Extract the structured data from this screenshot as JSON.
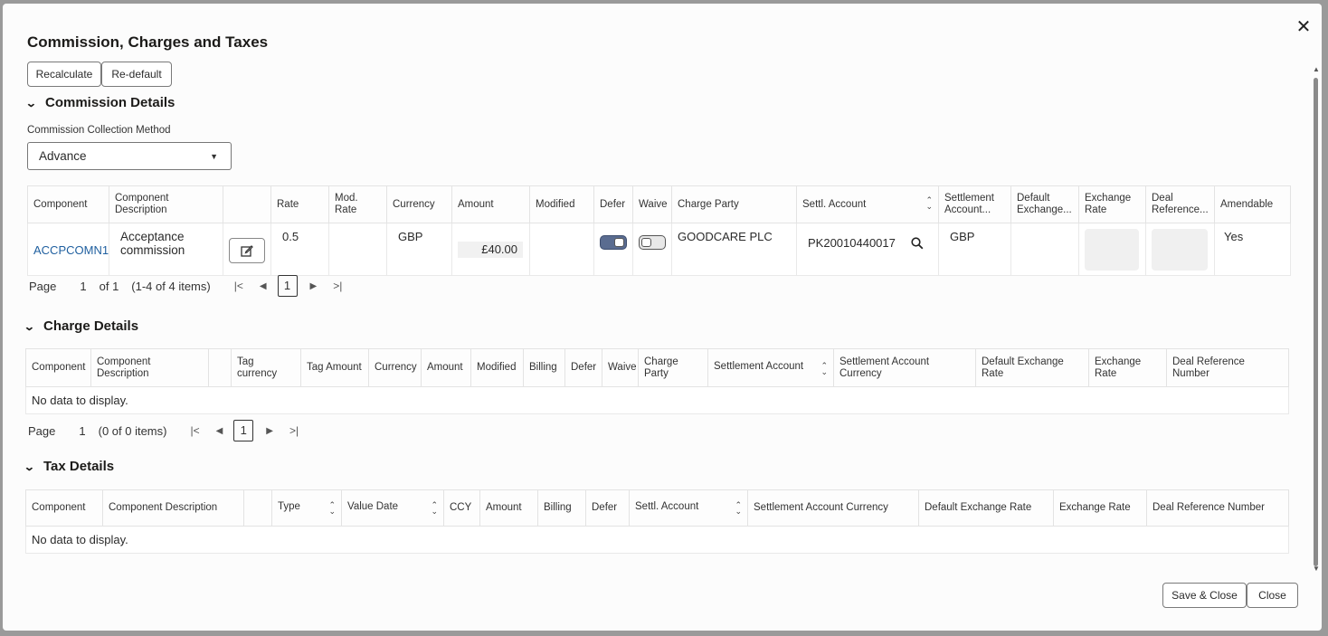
{
  "dialog": {
    "title": "Commission, Charges and Taxes",
    "close_icon": "close-icon"
  },
  "toolbar": {
    "recalculate_label": "Recalculate",
    "redefault_label": "Re-default"
  },
  "commission": {
    "section_title": "Commission Details",
    "collection_method_label": "Commission Collection Method",
    "collection_method_value": "Advance",
    "headers": {
      "component": "Component",
      "component_description": "Component Description",
      "rate": "Rate",
      "mod_rate": "Mod. Rate",
      "currency": "Currency",
      "amount": "Amount",
      "modified": "Modified",
      "defer": "Defer",
      "waive": "Waive",
      "charge_party": "Charge Party",
      "settl_account": "Settl. Account",
      "settlement_account": "Settlement Account...",
      "default_exchange": "Default Exchange...",
      "exchange_rate": "Exchange Rate",
      "deal_reference": "Deal Reference...",
      "amendable": "Amendable"
    },
    "row": {
      "component": "ACCPCOMN1",
      "description": "Acceptance commission",
      "rate": "0.5",
      "currency": "GBP",
      "amount": "£40.00",
      "defer_on": true,
      "waive_on": false,
      "charge_party": "GOODCARE PLC",
      "settl_account": "PK20010440017",
      "settlement_currency": "GBP",
      "amendable": "Yes"
    },
    "pager": {
      "page_label": "Page",
      "page_value": "1",
      "of_label": "of 1",
      "items": "(1-4 of 4 items)",
      "current": "1"
    }
  },
  "charges": {
    "section_title": "Charge Details",
    "headers": {
      "component": "Component",
      "component_description": "Component Description",
      "tag_currency": "Tag currency",
      "tag_amount": "Tag Amount",
      "currency": "Currency",
      "amount": "Amount",
      "modified": "Modified",
      "billing": "Billing",
      "defer": "Defer",
      "waive": "Waive",
      "charge_party": "Charge Party",
      "settlement_account": "Settlement Account",
      "settlement_account_currency": "Settlement Account Currency",
      "default_exchange_rate": "Default Exchange Rate",
      "exchange_rate": "Exchange Rate",
      "deal_reference_number": "Deal Reference Number"
    },
    "empty_text": "No data to display.",
    "pager": {
      "page_label": "Page",
      "page_value": "1",
      "items": "(0 of 0 items)",
      "current": "1"
    }
  },
  "taxes": {
    "section_title": "Tax Details",
    "headers": {
      "component": "Component",
      "component_description": "Component Description",
      "type": "Type",
      "value_date": "Value Date",
      "ccy": "CCY",
      "amount": "Amount",
      "billing": "Billing",
      "defer": "Defer",
      "settl_account": "Settl. Account",
      "settlement_account_currency": "Settlement Account Currency",
      "default_exchange_rate": "Default Exchange Rate",
      "exchange_rate": "Exchange Rate",
      "deal_reference_number": "Deal Reference Number"
    },
    "empty_text": "No data to display."
  },
  "footer": {
    "save_close_label": "Save & Close",
    "close_label": "Close"
  }
}
